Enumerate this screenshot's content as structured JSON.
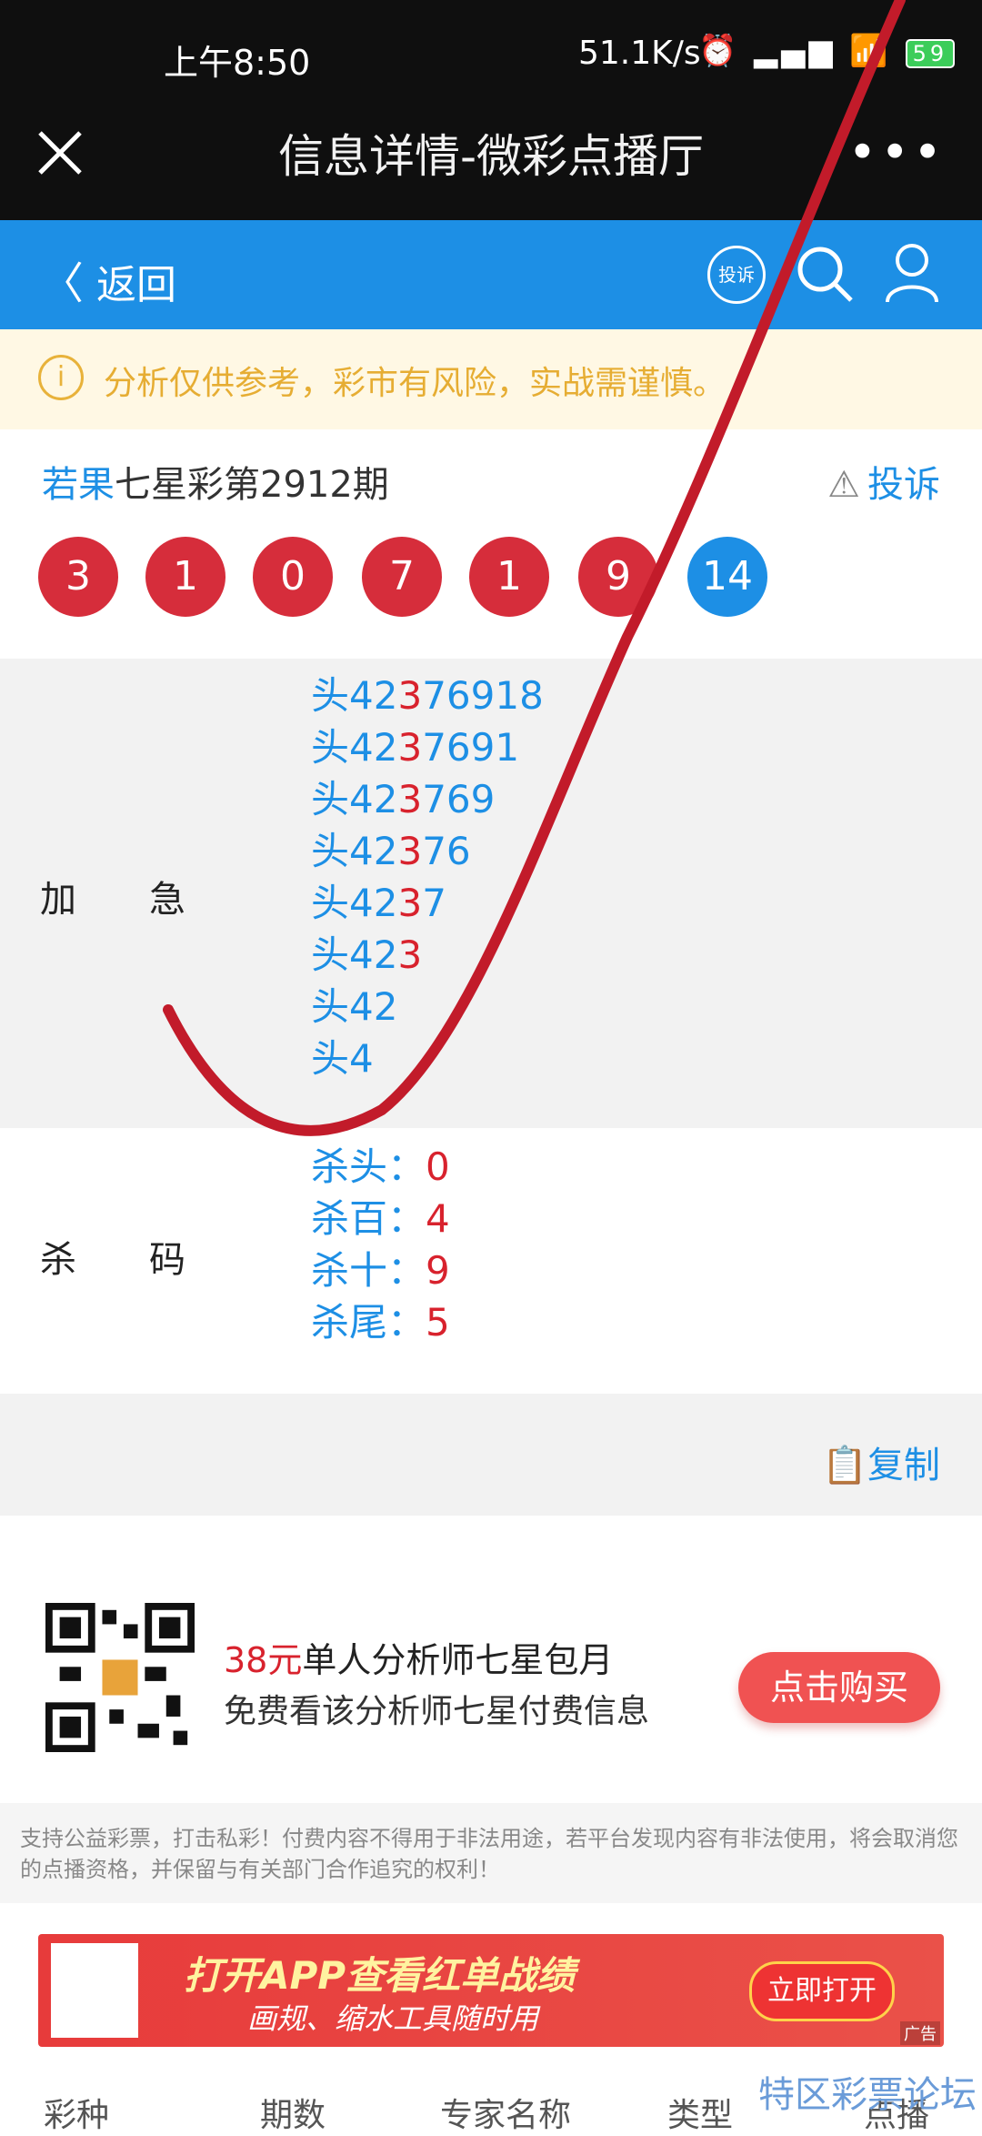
{
  "status_bar": {
    "time": "上午8:50",
    "net_speed": "51.1K/s",
    "battery": "59"
  },
  "titlebar": {
    "title": "信息详情-微彩点播厅",
    "more": "•••"
  },
  "navbar": {
    "back_label": "返回",
    "complain_label": "投诉"
  },
  "notice": {
    "icon": "i",
    "text": "分析仅供参考，彩市有风险，实战需谨慎。"
  },
  "issue": {
    "author": "若果",
    "title": "七星彩第2912期",
    "report_label": "投诉"
  },
  "balls": [
    "3",
    "1",
    "0",
    "7",
    "1",
    "9",
    "14"
  ],
  "jiaji": {
    "label": "加急",
    "lines": [
      {
        "pre": "头42",
        "red": "3",
        "post": "76918"
      },
      {
        "pre": "头42",
        "red": "3",
        "post": "7691"
      },
      {
        "pre": "头42",
        "red": "3",
        "post": "769"
      },
      {
        "pre": "头42",
        "red": "3",
        "post": "76"
      },
      {
        "pre": "头42",
        "red": "3",
        "post": "7"
      },
      {
        "pre": "头42",
        "red": "3",
        "post": ""
      },
      {
        "pre": "头42",
        "red": "",
        "post": ""
      },
      {
        "pre": "头4",
        "red": "",
        "post": ""
      }
    ]
  },
  "shama": {
    "label": "杀码",
    "lines": [
      {
        "pre": "杀头：",
        "red": "0"
      },
      {
        "pre": "杀百：",
        "red": "4"
      },
      {
        "pre": "杀十：",
        "red": "9"
      },
      {
        "pre": "杀尾：",
        "red": "5"
      }
    ]
  },
  "copy": {
    "label": "复制"
  },
  "promo": {
    "price": "38元",
    "line1": "单人分析师七星包月",
    "line2": "免费看该分析师七星付费信息",
    "buy_label": "点击购买"
  },
  "disclaimer": "支持公益彩票，打击私彩！付费内容不得用于非法用途，若平台发现内容有非法使用，将会取消您的点播资格，并保留与有关部门合作追究的权利！",
  "banner": {
    "headline": "打开APP查看红单战绩",
    "sub": "画规、缩水工具随时用",
    "open_label": "立即打开",
    "ad_label": "广告"
  },
  "bottom_tabs": [
    "彩种",
    "期数",
    "专家名称",
    "类型",
    "点播"
  ],
  "watermark": "特区彩票论坛"
}
